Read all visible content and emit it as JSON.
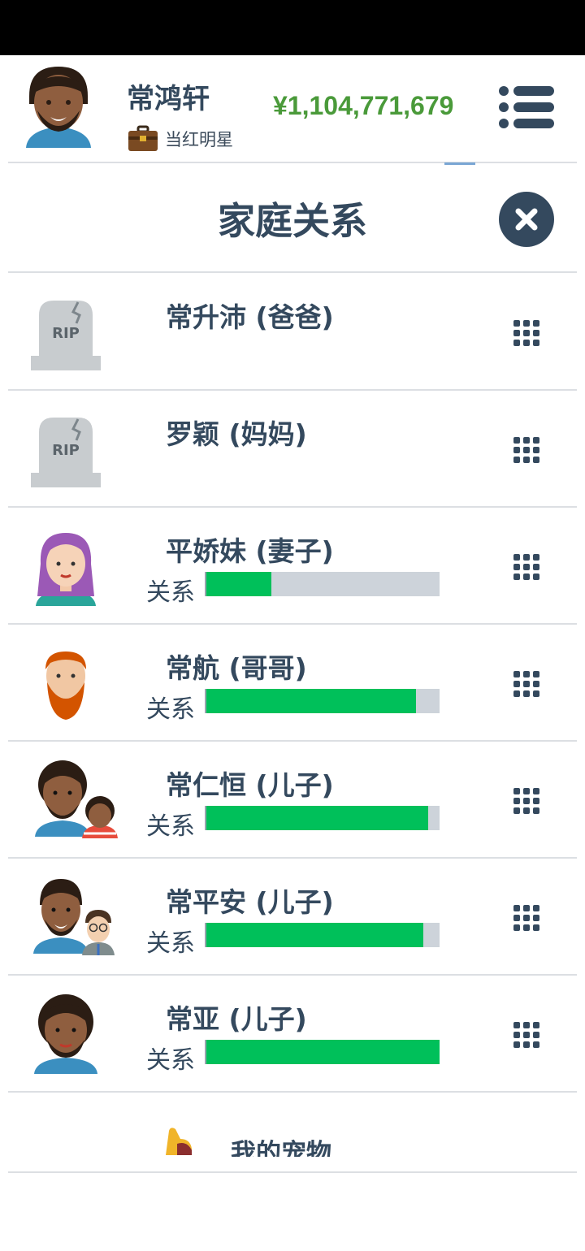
{
  "header": {
    "player_name": "常鸿轩",
    "job": "当红明星",
    "money": "¥1,104,771,679"
  },
  "dialog": {
    "title": "家庭关系"
  },
  "relationship_label": "关系",
  "members": [
    {
      "name": "常升沛 (爸爸)",
      "status": "deceased",
      "relationship": null
    },
    {
      "name": "罗颖 (妈妈)",
      "status": "deceased",
      "relationship": null
    },
    {
      "name": "平娇妹 (妻子)",
      "status": "alive",
      "relationship": 0.28
    },
    {
      "name": "常航 (哥哥)",
      "status": "alive",
      "relationship": 0.9
    },
    {
      "name": "常仁恒 (儿子)",
      "status": "alive",
      "relationship": 0.95
    },
    {
      "name": "常平安 (儿子)",
      "status": "alive",
      "relationship": 0.93
    },
    {
      "name": "常亚 (儿子)",
      "status": "alive",
      "relationship": 1.0
    }
  ],
  "pets": {
    "label": "我的宠物"
  },
  "icons": {
    "menu": "hamburger-menu-icon",
    "close": "close-icon",
    "options": "grid-dots-icon",
    "job": "briefcase-icon",
    "grave": "tombstone-rip-icon",
    "pet": "dog-icon"
  },
  "colors": {
    "money": "#4a9a3a",
    "bar_fill": "#00c05a",
    "bar_track": "#cdd3da",
    "dark": "#34495e"
  }
}
